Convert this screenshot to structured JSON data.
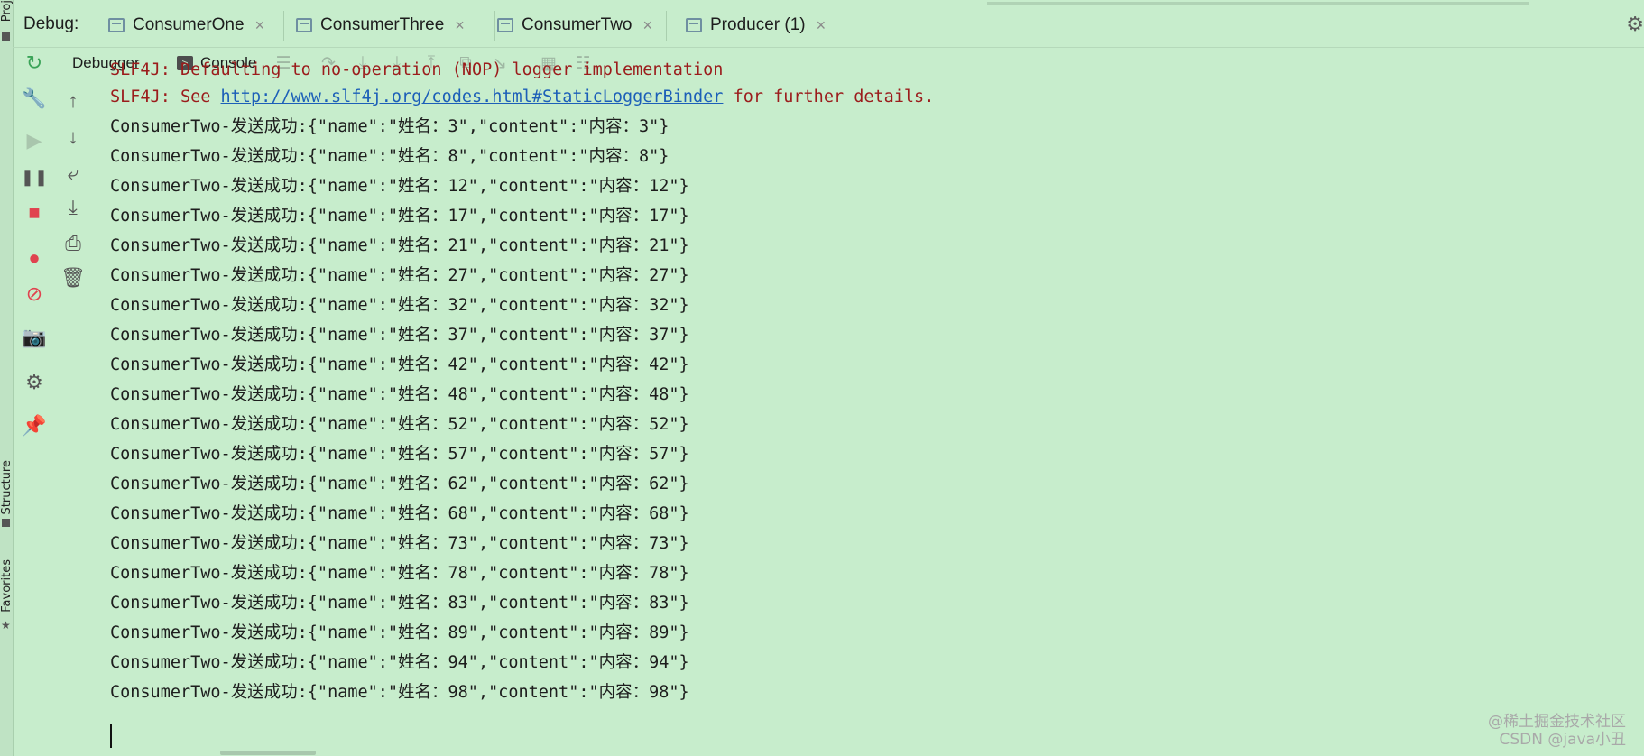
{
  "window": {
    "debug_label": "Debug:",
    "tabs": [
      {
        "label": "ConsumerOne",
        "close": "×"
      },
      {
        "label": "ConsumerThree",
        "close": "×"
      },
      {
        "label": "ConsumerTwo",
        "close": "×"
      },
      {
        "label": "Producer (1)",
        "close": "×"
      }
    ],
    "side_tabs": {
      "project": "Proj",
      "structure": "Structure",
      "favorites": "Favorites"
    }
  },
  "toolbar": {
    "debugger_label": "Debugger",
    "console_label": "Console",
    "icons": [
      "rerun-icon",
      "frames-icon",
      "step-over-icon",
      "step-into-icon",
      "force-step-into-icon",
      "step-out-icon",
      "drop-frame-icon",
      "run-to-cursor-icon",
      "evaluate-icon",
      "trace-icon"
    ]
  },
  "console": {
    "slf4j_line1": "SLF4J: Defaulting to no-operation (NOP) logger implementation",
    "slf4j_line2_prefix": "SLF4J: See ",
    "slf4j_line2_link": "http://www.slf4j.org/codes.html#StaticLoggerBinder",
    "slf4j_line2_suffix": " for further details.",
    "lines": [
      "ConsumerTwo-发送成功:{\"name\":\"姓名：3\",\"content\":\"内容：3\"}",
      "ConsumerTwo-发送成功:{\"name\":\"姓名：8\",\"content\":\"内容：8\"}",
      "ConsumerTwo-发送成功:{\"name\":\"姓名：12\",\"content\":\"内容：12\"}",
      "ConsumerTwo-发送成功:{\"name\":\"姓名：17\",\"content\":\"内容：17\"}",
      "ConsumerTwo-发送成功:{\"name\":\"姓名：21\",\"content\":\"内容：21\"}",
      "ConsumerTwo-发送成功:{\"name\":\"姓名：27\",\"content\":\"内容：27\"}",
      "ConsumerTwo-发送成功:{\"name\":\"姓名：32\",\"content\":\"内容：32\"}",
      "ConsumerTwo-发送成功:{\"name\":\"姓名：37\",\"content\":\"内容：37\"}",
      "ConsumerTwo-发送成功:{\"name\":\"姓名：42\",\"content\":\"内容：42\"}",
      "ConsumerTwo-发送成功:{\"name\":\"姓名：48\",\"content\":\"内容：48\"}",
      "ConsumerTwo-发送成功:{\"name\":\"姓名：52\",\"content\":\"内容：52\"}",
      "ConsumerTwo-发送成功:{\"name\":\"姓名：57\",\"content\":\"内容：57\"}",
      "ConsumerTwo-发送成功:{\"name\":\"姓名：62\",\"content\":\"内容：62\"}",
      "ConsumerTwo-发送成功:{\"name\":\"姓名：68\",\"content\":\"内容：68\"}",
      "ConsumerTwo-发送成功:{\"name\":\"姓名：73\",\"content\":\"内容：73\"}",
      "ConsumerTwo-发送成功:{\"name\":\"姓名：78\",\"content\":\"内容：78\"}",
      "ConsumerTwo-发送成功:{\"name\":\"姓名：83\",\"content\":\"内容：83\"}",
      "ConsumerTwo-发送成功:{\"name\":\"姓名：89\",\"content\":\"内容：89\"}",
      "ConsumerTwo-发送成功:{\"name\":\"姓名：94\",\"content\":\"内容：94\"}",
      "ConsumerTwo-发送成功:{\"name\":\"姓名：98\",\"content\":\"内容：98\"}"
    ]
  },
  "watermark": {
    "line1": "@稀土掘金技术社区",
    "line2": "CSDN @java小丑"
  },
  "colors": {
    "background": "#c7edcc",
    "error_text": "#9b1c1c",
    "link": "#1c5fb8",
    "stop": "#e0434f",
    "rerun": "#3aa357"
  }
}
